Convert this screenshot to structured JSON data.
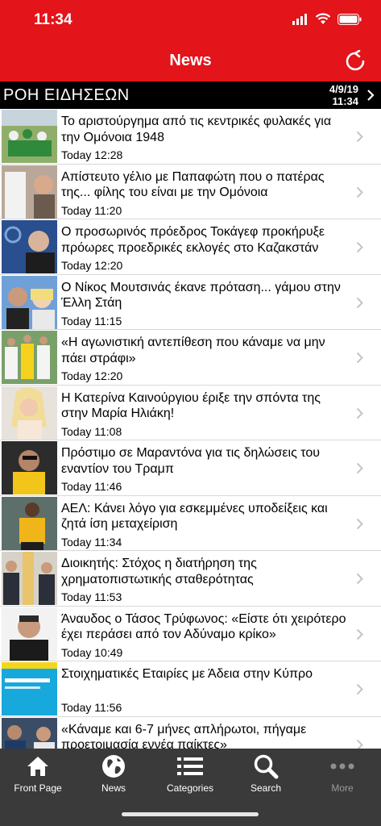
{
  "status_bar": {
    "time": "11:34"
  },
  "header": {
    "title": "News",
    "refresh_icon": "refresh-icon"
  },
  "ticker": {
    "title": "ΡΟΗ ΕΙΔΗΣΕΩΝ",
    "date": "4/9/19",
    "time": "11:34"
  },
  "news": [
    {
      "title": "Το αριστούργημα από τις κεντρικές φυλακές για την Ομόνοια 1948",
      "time": "Today 12:28"
    },
    {
      "title": "Απίστευτο γέλιο με Παπαφώτη που ο πατέρας της... φίλης του είναι με την Ομόνοια",
      "time": "Today 11:20"
    },
    {
      "title": "Ο προσωρινός πρόεδρος Τοκάγεφ προκήρυξε πρόωρες προεδρικές εκλογές στο Καζακστάν",
      "time": "Today 12:20"
    },
    {
      "title": "Ο Νίκος Μουτσινάς έκανε πρόταση... γάμου στην Έλλη Στάη",
      "time": "Today 11:15"
    },
    {
      "title": "«Η αγωνιστική αντεπίθεση που κάναμε να μην πάει στράφι»",
      "time": "Today 12:20"
    },
    {
      "title": "Η Κατερίνα Καινούργιου έριξε την σπόντα της στην Μαρία Ηλιάκη!",
      "time": "Today 11:08"
    },
    {
      "title": "Πρόστιμο σε Μαραντόνα για τις δηλώσεις του εναντίον του Τραμπ",
      "time": "Today 11:46"
    },
    {
      "title": "ΑΕΛ: Κάνει λόγο για εσκεμμένες υποδείξεις και ζητά ίση μεταχείριση",
      "time": "Today 11:34"
    },
    {
      "title": "Διοικητής: Στόχος η διατήρηση της χρηματοπιστωτικής σταθερότητας",
      "time": "Today 11:53"
    },
    {
      "title": "Άναυδος ο Τάσος Τρύφωνος: «Είστε ότι χειρότερο έχει περάσει από τον Αδύναμο κρίκο»",
      "time": "Today 10:49"
    },
    {
      "title": "Στοιχηματικές Εταιρίες με Άδεια στην Κύπρο",
      "time": "Today 11:56"
    },
    {
      "title": "«Κάναμε και 6-7 μήνες απλήρωτοι, πήγαμε προετοιμασία εννέα παίκτες»",
      "time": ""
    }
  ],
  "tabs": [
    {
      "label": "Front Page",
      "icon": "home-icon"
    },
    {
      "label": "News",
      "icon": "globe-icon"
    },
    {
      "label": "Categories",
      "icon": "list-icon"
    },
    {
      "label": "Search",
      "icon": "search-icon"
    },
    {
      "label": "More",
      "icon": "more-icon"
    }
  ],
  "colors": {
    "brand_red": "#e3141a",
    "ticker_bg": "#000000",
    "tab_bar_bg": "#3a3a3a"
  }
}
